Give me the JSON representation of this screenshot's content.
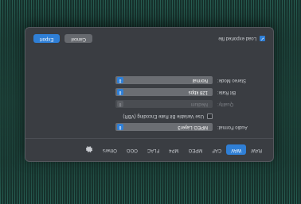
{
  "tabs": [
    {
      "label": "RAW",
      "active": false
    },
    {
      "label": "WAV",
      "active": true
    },
    {
      "label": "CAF",
      "active": false
    },
    {
      "label": "MPEG",
      "active": false
    },
    {
      "label": "MP4",
      "active": false
    },
    {
      "label": "FLAC",
      "active": false
    },
    {
      "label": "OGG",
      "active": false
    },
    {
      "label": "Others",
      "active": false
    }
  ],
  "icons": {
    "settings": "gear-icon",
    "select": "chevron-up-down-icon",
    "check": "checkmark-icon"
  },
  "audio_format": {
    "label": "Audio Format:",
    "value": "MPEG Layer3"
  },
  "vbr": {
    "label": "Use Variable Bit Rate Encoding (VBR)",
    "checked": false
  },
  "quality": {
    "label": "Quality:",
    "value": "Medium"
  },
  "bit_rate": {
    "label": "Bit Rate:",
    "value": "128 kbps"
  },
  "stereo_mode": {
    "label": "Stereo Mode:",
    "value": "Normal"
  },
  "load_exported": {
    "label": "Load exported file",
    "checked": true
  },
  "buttons": {
    "cancel": "Cancel",
    "export": "Export"
  },
  "colors": {
    "accent": "#2f7fd6",
    "dialog": "#3a3d42",
    "background": "#16302b"
  }
}
